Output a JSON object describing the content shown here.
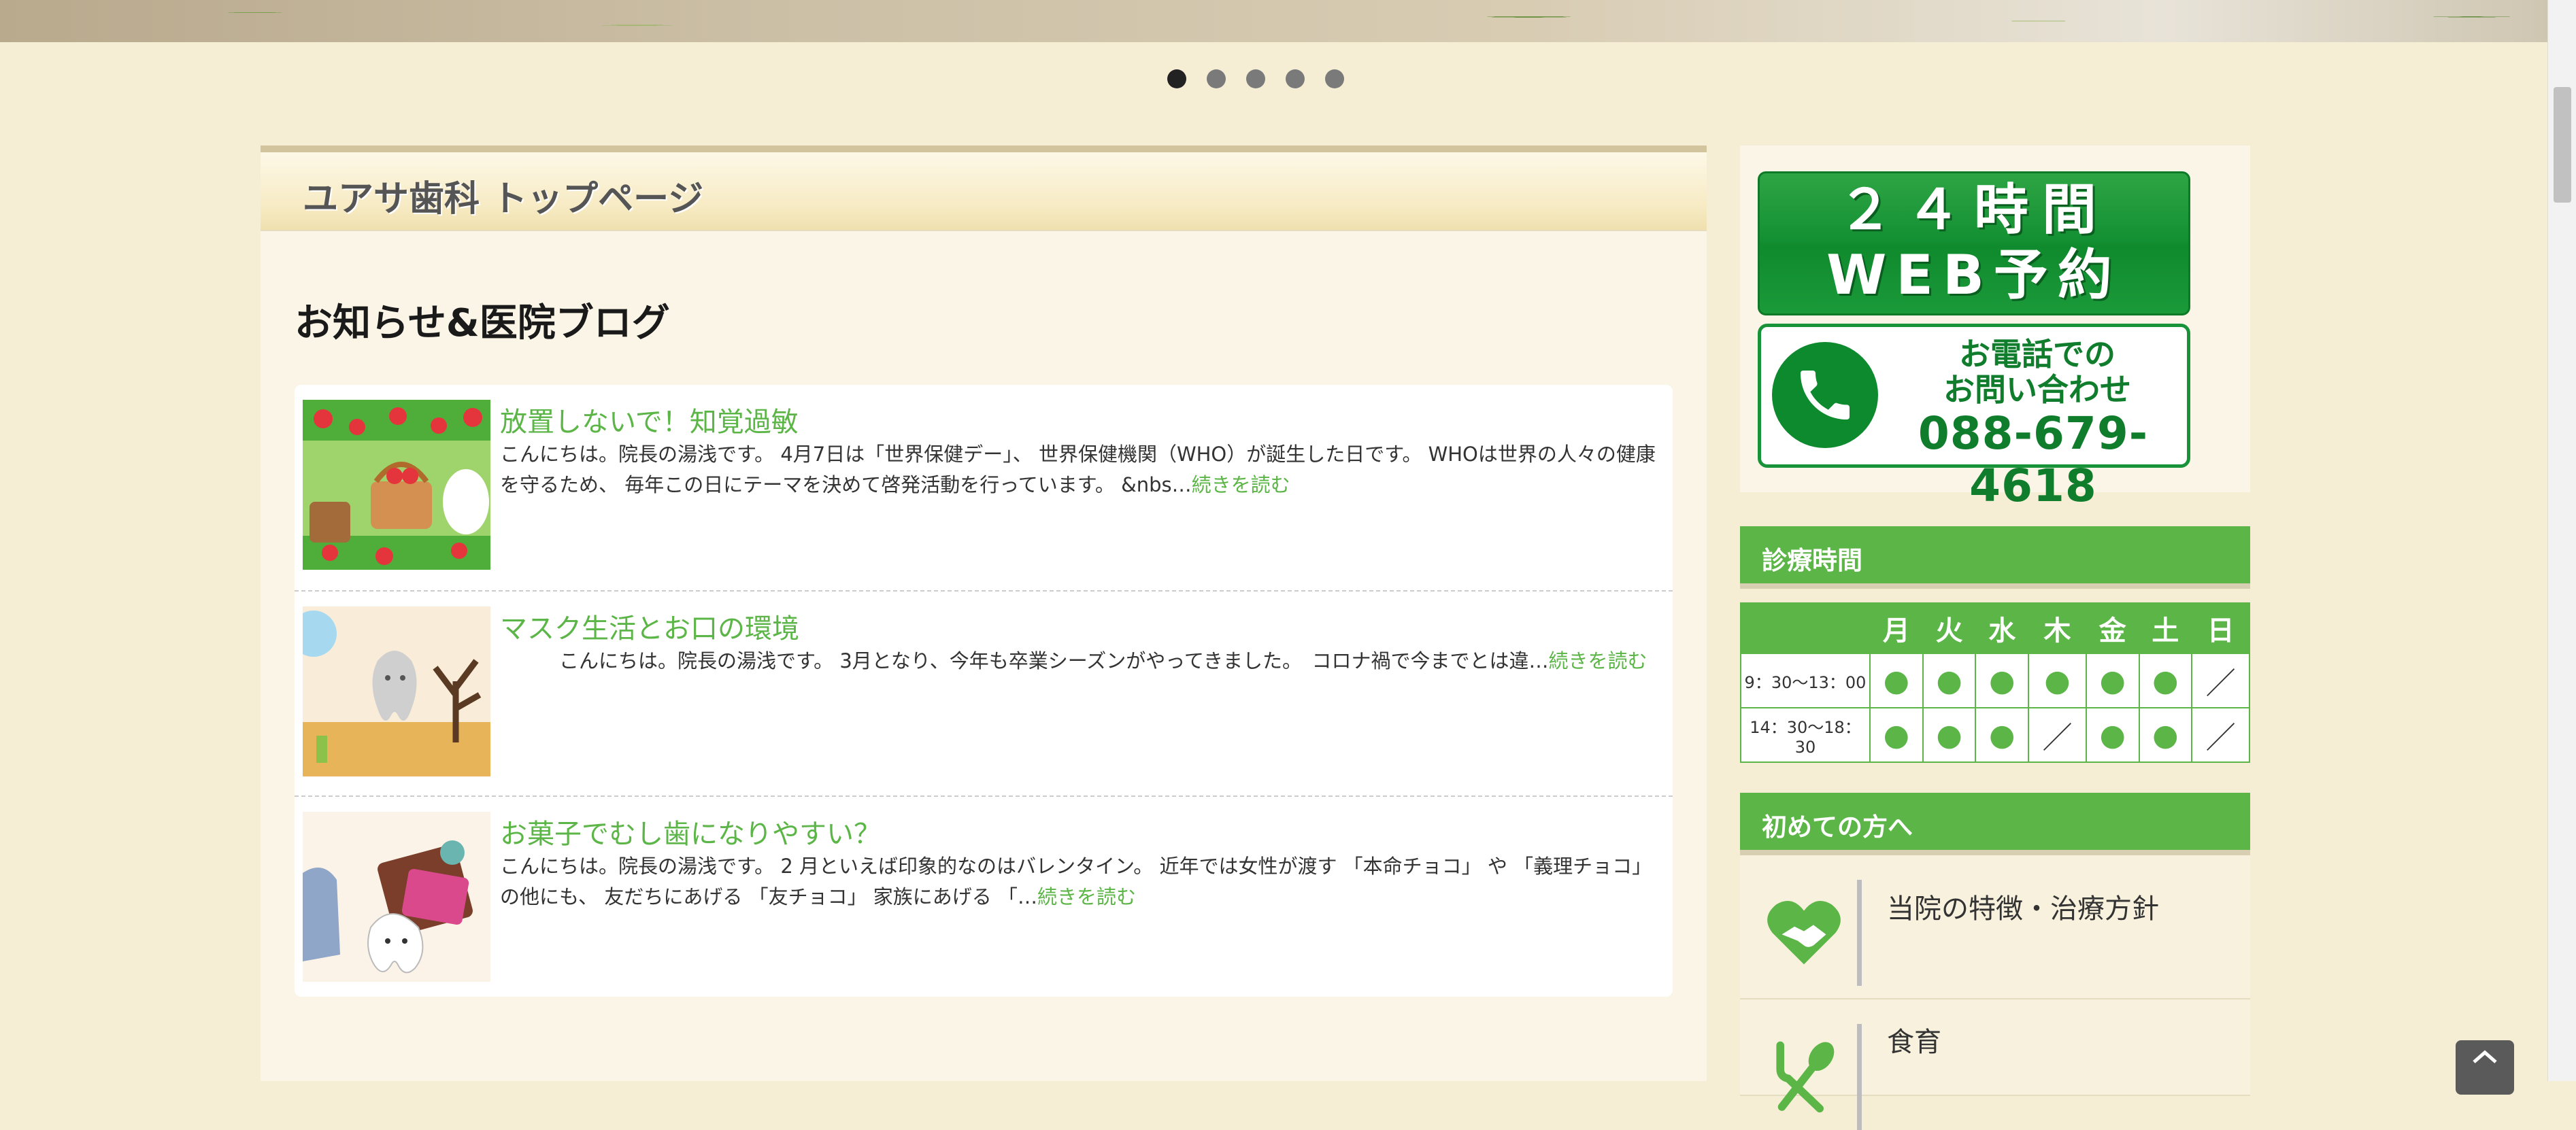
{
  "slider": {
    "dot_count": 5,
    "active_index": 0
  },
  "page": {
    "title": "ユアサ歯科 トップページ"
  },
  "blog": {
    "heading": "お知らせ&医院ブログ",
    "posts": [
      {
        "title": "放置しないで！知覚過敏",
        "excerpt": "こんにちは。院長の湯浅です。 4月7日は「世界保健デー」、 世界保健機関（WHO）が誕生した日です。 WHOは世界の人々の健康を守るため、 毎年この日にテーマを決めて啓発活動を行っています。 &nbs…",
        "more": "続きを読む"
      },
      {
        "title": "マスク生活とお口の環境",
        "excerpt": "　　　こんにちは。院長の湯浅です。 3月となり、今年も卒業シーズンがやってきました。　コロナ禍で今までとは違…",
        "more": "続きを読む"
      },
      {
        "title": "お菓子でむし歯になりやすい？",
        "excerpt": " こんにちは。院長の湯浅です。 2 月といえば印象的なのはバレンタイン。 近年では女性が渡す 「本命チョコ」 や 「義理チョコ」 の他にも、 友だちにあげる 「友チョコ」 家族にあげる 「…",
        "more": "続きを読む"
      }
    ]
  },
  "sidebar": {
    "web_banner": {
      "line1": "２４時間",
      "line2": "WEB予約"
    },
    "tel_banner": {
      "line1": "お電話での",
      "line2": "お問い合わせ",
      "number": "088-679-4618"
    },
    "hours": {
      "heading": "診療時間",
      "days": [
        "月",
        "火",
        "水",
        "木",
        "金",
        "土",
        "日"
      ],
      "rows": [
        {
          "time": "9：30～13：00",
          "marks": [
            "●",
            "●",
            "●",
            "●",
            "●",
            "●",
            "／"
          ]
        },
        {
          "time": "14：30～18：30",
          "marks": [
            "●",
            "●",
            "●",
            "／",
            "●",
            "●",
            "／"
          ]
        }
      ]
    },
    "first_visit": {
      "heading": "初めての方へ",
      "items": [
        {
          "label": "当院の特徴・治療方針",
          "icon": "heart-handshake-icon"
        },
        {
          "label": "食育",
          "icon": "fork-spoon-icon"
        }
      ]
    }
  },
  "colors": {
    "accent_green": "#5cb547",
    "banner_green": "#139033",
    "background": "#f6eed4"
  }
}
